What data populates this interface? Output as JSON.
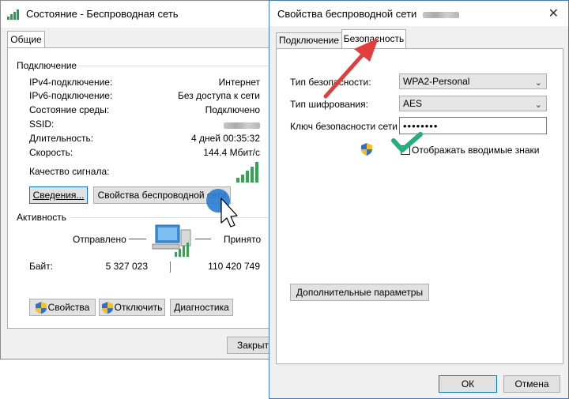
{
  "colors": {
    "accent": "#0078d7",
    "arrow_red": "#e43d3d",
    "check_green": "#21b179",
    "cursor_blue": "#2d7fd2"
  },
  "status_window": {
    "title": "Состояние - Беспроводная сеть",
    "tabs": [
      "Общие"
    ],
    "connection_group": "Подключение",
    "rows": [
      {
        "label": "IPv4-подключение:",
        "value": "Интернет"
      },
      {
        "label": "IPv6-подключение:",
        "value": "Без доступа к сети"
      },
      {
        "label": "Состояние среды:",
        "value": "Подключено"
      },
      {
        "label": "SSID:",
        "value": ""
      },
      {
        "label": "Длительность:",
        "value": "4 дней 00:35:32"
      },
      {
        "label": "Скорость:",
        "value": "144.4 Мбит/с"
      }
    ],
    "signal_label": "Качество сигнала:",
    "details_button": "Сведения...",
    "wireless_props_button": "Свойства беспроводной сети",
    "activity_group": "Активность",
    "sent_label": "Отправлено",
    "received_label": "Принято",
    "bytes_label": "Байт:",
    "bytes_sent": "5 327 023",
    "bytes_received": "110 420 749",
    "properties_button": "Свойства",
    "disable_button": "Отключить",
    "diagnose_button": "Диагностика",
    "close_button": "Закрыть"
  },
  "props_window": {
    "title": "Свойства беспроводной сети",
    "close_glyph": "✕",
    "tabs": [
      "Подключение",
      "Безопасность"
    ],
    "security_type_label": "Тип безопасности:",
    "security_type_value": "WPA2-Personal",
    "encryption_label": "Тип шифрования:",
    "encryption_value": "AES",
    "key_label": "Ключ безопасности сети",
    "key_value": "••••••••",
    "show_chars_label": "Отображать вводимые знаки",
    "advanced_button": "Дополнительные параметры",
    "ok_button": "ОК",
    "cancel_button": "Отмена"
  }
}
